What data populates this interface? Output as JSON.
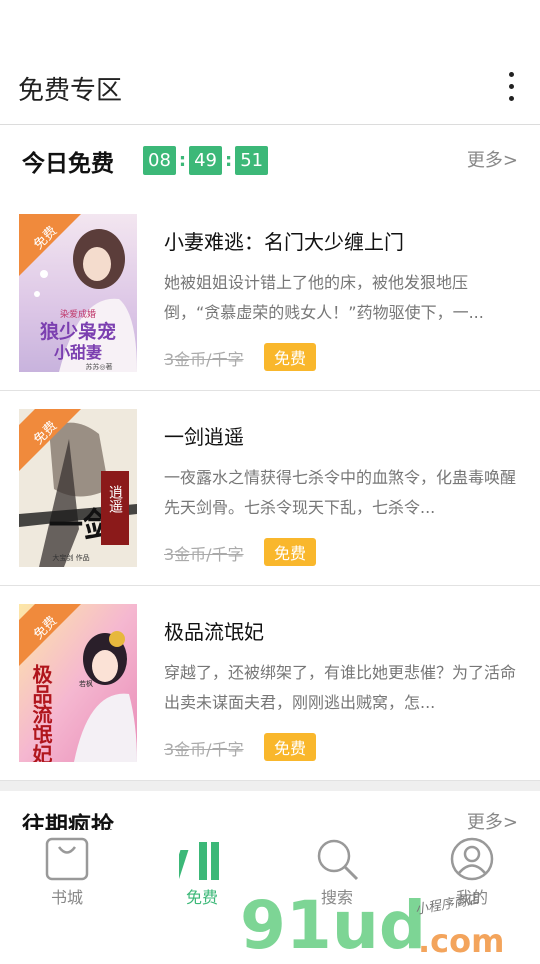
{
  "header": {
    "title": "免费专区",
    "menu_icon": "more-vertical-icon"
  },
  "today_section": {
    "title": "今日免费",
    "more": "更多>",
    "countdown": {
      "hours": "08",
      "minutes": "49",
      "seconds": "51"
    }
  },
  "books": [
    {
      "title": "小妻难逃：名门大少缠上门",
      "description": "她被姐姐设计错上了他的床，被他发狠地压倒，“贪慕虚荣的贱女人！”药物驱使下，一...",
      "price": "3金币/千字",
      "free_label": "免费",
      "cover_badge": "免费",
      "cover_text": {
        "main": "狼少枭宠",
        "sub": "小甜妻",
        "tagline": "染爱成婚",
        "author": "苏苏◎著"
      }
    },
    {
      "title": "一剑逍遥",
      "description": "一夜露水之情获得七杀令中的血煞令，化蛊毒唤醒先天剑骨。七杀令现天下乱，七杀令...",
      "price": "3金币/千字",
      "free_label": "免费",
      "cover_badge": "免费",
      "cover_text": {
        "main": "一剑",
        "sub": "逍遥",
        "author": "大宝剑 作品"
      }
    },
    {
      "title": "极品流氓妃",
      "description": "穿越了，还被绑架了，有谁比她更悲催？为了活命出卖未谋面夫君，刚刚逃出贼窝，怎...",
      "price": "3金币/千字",
      "free_label": "免费",
      "cover_badge": "免费",
      "cover_text": {
        "main": "极品流氓妃",
        "author": "若枫"
      }
    }
  ],
  "past_section": {
    "title": "往期疯抢",
    "more": "更多>"
  },
  "bottom_nav": [
    {
      "label": "书城",
      "icon": "bag-icon",
      "active": false
    },
    {
      "label": "免费",
      "icon": "books-icon",
      "active": true
    },
    {
      "label": "搜索",
      "icon": "search-icon",
      "active": false
    },
    {
      "label": "我的",
      "icon": "user-icon",
      "active": false
    }
  ],
  "watermark": {
    "brand": "91ud",
    "suffix": ".com",
    "tagline": "小程序商店"
  },
  "colors": {
    "accent_green": "#3cb878",
    "free_tag": "#f9b72c",
    "badge_orange": "#f08a3c"
  }
}
